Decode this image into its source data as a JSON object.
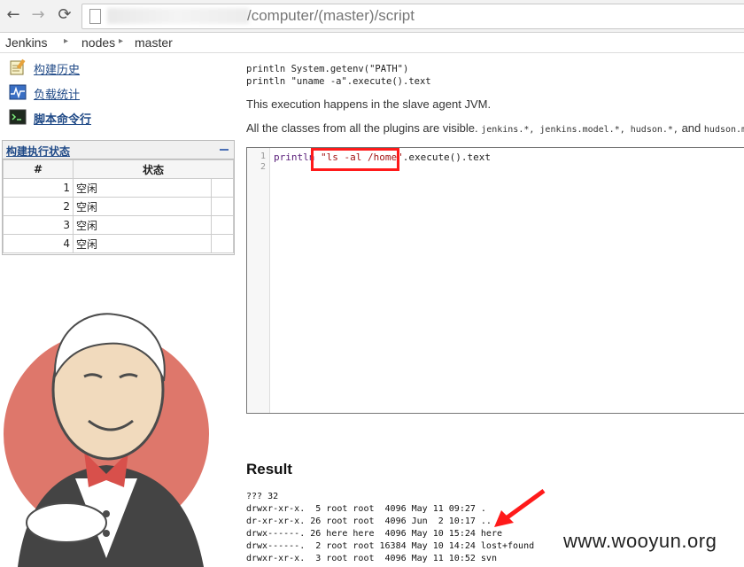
{
  "browser": {
    "back_icon": "←",
    "forward_icon": "→",
    "reload_icon": "⟳",
    "url_path": "/computer/(master)/script"
  },
  "breadcrumb": [
    "Jenkins",
    "nodes",
    "master"
  ],
  "sidebar": {
    "tasks": [
      {
        "label": "构建历史",
        "icon": "notepad-icon"
      },
      {
        "label": "负载统计",
        "icon": "chart-icon"
      },
      {
        "label": "脚本命令行",
        "icon": "terminal-icon"
      }
    ],
    "executor_panel": {
      "title": "构建执行状态",
      "headers": [
        "#",
        "状态"
      ],
      "rows": [
        {
          "num": "1",
          "status": "空闲"
        },
        {
          "num": "2",
          "status": "空闲"
        },
        {
          "num": "3",
          "status": "空闲"
        },
        {
          "num": "4",
          "status": "空闲"
        }
      ]
    }
  },
  "main": {
    "example_lines": [
      "println System.getenv(\"PATH\")",
      "println \"uname -a\".execute().text"
    ],
    "slave_note": "This execution happens in the slave agent JVM.",
    "classes_note_prefix": "All the classes from all the plugins are visible.",
    "classes_pkgs": "jenkins.*, jenkins.model.*, hudson.*,",
    "classes_and": "and",
    "classes_tail": "hudson.m",
    "editor": {
      "line_numbers": [
        "1",
        "2"
      ],
      "code_keyword": "println",
      "code_string": "\"ls -al /home\"",
      "code_rest": ".execute().text"
    },
    "result_heading": "Result",
    "result_lines": [
      "??? 32",
      "drwxr-xr-x.  5 root root  4096 May 11 09:27 .",
      "dr-xr-xr-x. 26 root root  4096 Jun  2 10:17 ..",
      "drwx------. 26 here here  4096 May 10 15:24 here",
      "drwx------.  2 root root 16384 May 10 14:24 lost+found",
      "drwxr-xr-x.  3 root root  4096 May 11 10:52 svn"
    ]
  },
  "watermark": "www.wooyun.org",
  "colors": {
    "highlight": "#ff1a1a",
    "link": "#204a87"
  }
}
